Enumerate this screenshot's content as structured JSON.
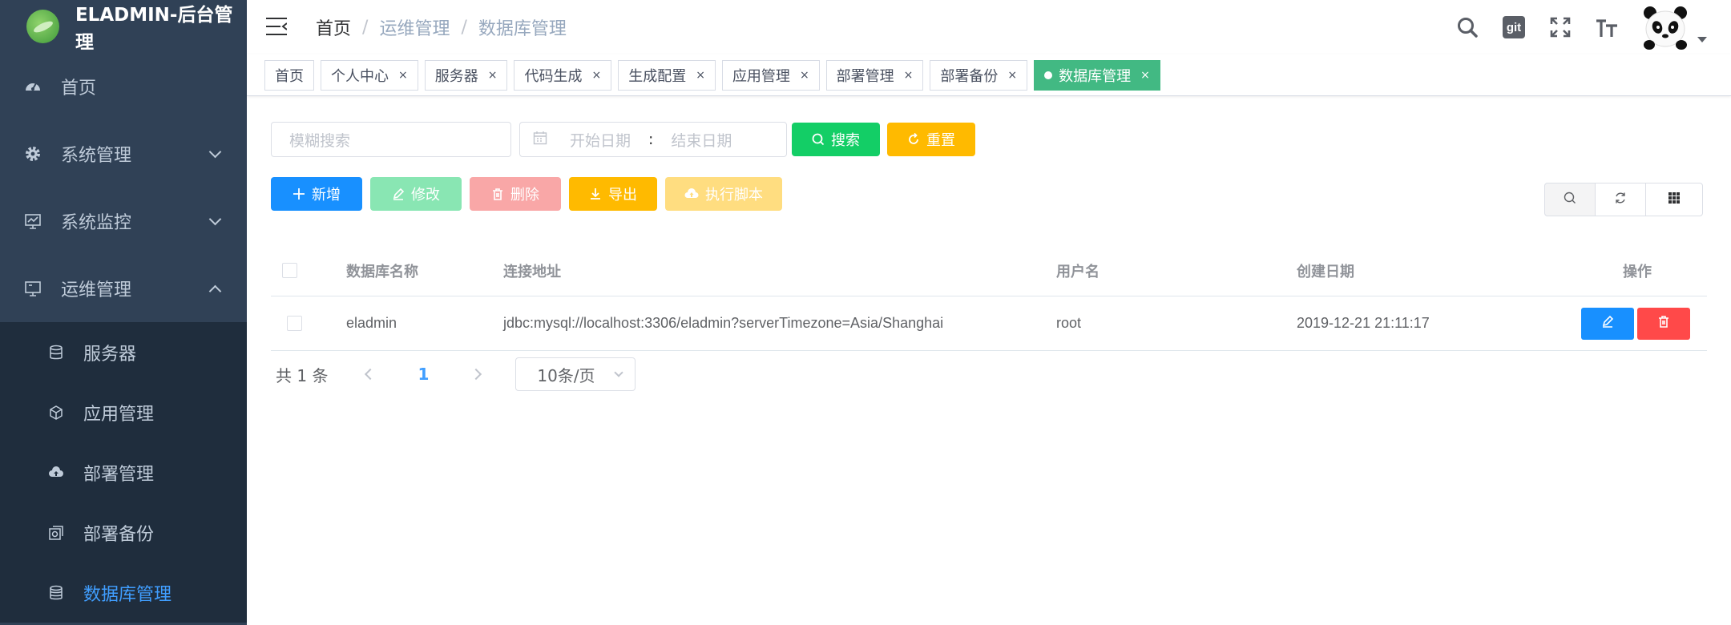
{
  "app": {
    "title": "ELADMIN-后台管理"
  },
  "sidebar": {
    "items": [
      {
        "label": "首页",
        "icon": "dashboard-icon"
      },
      {
        "label": "系统管理",
        "icon": "gear-icon"
      },
      {
        "label": "系统监控",
        "icon": "monitor-icon"
      },
      {
        "label": "运维管理",
        "icon": "computer-icon"
      }
    ],
    "subitems": [
      {
        "label": "服务器",
        "icon": "server-icon"
      },
      {
        "label": "应用管理",
        "icon": "cube-icon"
      },
      {
        "label": "部署管理",
        "icon": "cloud-upload-icon"
      },
      {
        "label": "部署备份",
        "icon": "backup-icon"
      },
      {
        "label": "数据库管理",
        "icon": "database-icon"
      }
    ]
  },
  "breadcrumb": [
    "首页",
    "运维管理",
    "数据库管理"
  ],
  "breadcrumb_sep": "/",
  "navbar": {
    "git_label": "git"
  },
  "tags": [
    {
      "label": "首页"
    },
    {
      "label": "个人中心"
    },
    {
      "label": "服务器"
    },
    {
      "label": "代码生成"
    },
    {
      "label": "生成配置"
    },
    {
      "label": "应用管理"
    },
    {
      "label": "部署管理"
    },
    {
      "label": "部署备份"
    },
    {
      "label": "数据库管理"
    }
  ],
  "tag_close": "×",
  "search": {
    "placeholder": "模糊搜索",
    "start_date": "开始日期",
    "colon": ":",
    "end_date": "结束日期"
  },
  "buttons": {
    "search": "搜索",
    "reset": "重置",
    "add": "新增",
    "edit": "修改",
    "delete": "删除",
    "export": "导出",
    "exec": "执行脚本"
  },
  "table": {
    "headers": [
      "数据库名称",
      "连接地址",
      "用户名",
      "创建日期",
      "操作"
    ],
    "rows": [
      {
        "name": "eladmin",
        "url": "jdbc:mysql://localhost:3306/eladmin?serverTimezone=Asia/Shanghai",
        "user": "root",
        "date": "2019-12-21 21:11:17"
      }
    ]
  },
  "pagination": {
    "total": "共 1 条",
    "page": "1",
    "size": "10条/页"
  },
  "colors": {
    "sidebar": "#304156",
    "submenu": "#1f2d3d",
    "active_tag": "#42b983",
    "primary": "#1890ff",
    "success": "#13ce66",
    "warning": "#ffba00",
    "danger": "#ff4949"
  }
}
